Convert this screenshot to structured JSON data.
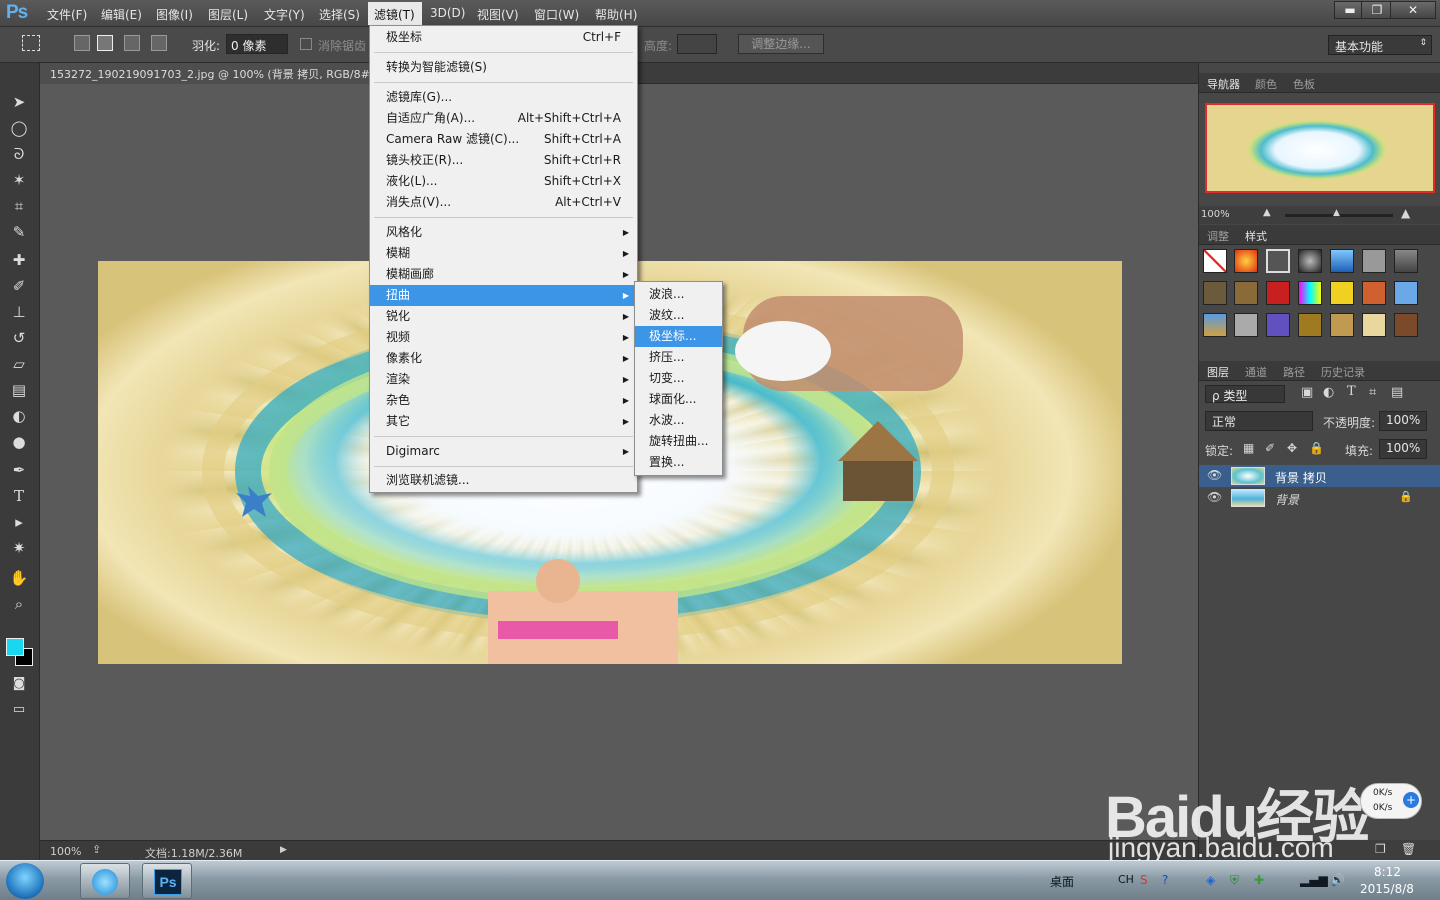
{
  "app": {
    "logo": "Ps"
  },
  "menubar": {
    "items": [
      "文件(F)",
      "编辑(E)",
      "图像(I)",
      "图层(L)",
      "文字(Y)",
      "选择(S)",
      "滤镜(T)",
      "3D(D)",
      "视图(V)",
      "窗口(W)",
      "帮助(H)"
    ],
    "window_controls": {
      "minimize": "▬",
      "restore": "❐",
      "close": "✕"
    }
  },
  "options": {
    "feather_label": "羽化:",
    "feather_value": "0 像素",
    "antialias": "消除锯齿",
    "height_label": "高度:",
    "refine_edge": "调整边缘...",
    "workspace": "基本功能"
  },
  "document": {
    "tab_title": "153272_190219091703_2.jpg @ 100% (背景 拷贝, RGB/8#)"
  },
  "status": {
    "zoom": "100%",
    "doc_info": "文档:1.18M/2.36M"
  },
  "filter_menu": {
    "items": [
      {
        "label": "极坐标",
        "shortcut": "Ctrl+F"
      },
      {
        "label": "转换为智能滤镜(S)",
        "shortcut": ""
      },
      {
        "label": "滤镜库(G)...",
        "shortcut": ""
      },
      {
        "label": "自适应广角(A)...",
        "shortcut": "Alt+Shift+Ctrl+A"
      },
      {
        "label": "Camera Raw 滤镜(C)...",
        "shortcut": "Shift+Ctrl+A"
      },
      {
        "label": "镜头校正(R)...",
        "shortcut": "Shift+Ctrl+R"
      },
      {
        "label": "液化(L)...",
        "shortcut": "Shift+Ctrl+X"
      },
      {
        "label": "消失点(V)...",
        "shortcut": "Alt+Ctrl+V"
      },
      {
        "label": "风格化",
        "shortcut": ""
      },
      {
        "label": "模糊",
        "shortcut": ""
      },
      {
        "label": "模糊画廊",
        "shortcut": ""
      },
      {
        "label": "扭曲",
        "shortcut": ""
      },
      {
        "label": "锐化",
        "shortcut": ""
      },
      {
        "label": "视频",
        "shortcut": ""
      },
      {
        "label": "像素化",
        "shortcut": ""
      },
      {
        "label": "渲染",
        "shortcut": ""
      },
      {
        "label": "杂色",
        "shortcut": ""
      },
      {
        "label": "其它",
        "shortcut": ""
      },
      {
        "label": "Digimarc",
        "shortcut": ""
      },
      {
        "label": "浏览联机滤镜...",
        "shortcut": ""
      }
    ]
  },
  "distort_submenu": {
    "items": [
      "波浪...",
      "波纹...",
      "极坐标...",
      "挤压...",
      "切变...",
      "球面化...",
      "水波...",
      "旋转扭曲...",
      "置换..."
    ]
  },
  "panels": {
    "nav_tabs": [
      "导航器",
      "颜色",
      "色板"
    ],
    "nav_zoom": "100%",
    "adjust_tabs": [
      "调整",
      "样式"
    ],
    "layer_tabs": [
      "图层",
      "通道",
      "路径",
      "历史记录"
    ],
    "kind_filter": "ρ 类型",
    "blend_mode": "正常",
    "opacity_label": "不透明度:",
    "opacity_value": "100%",
    "lock_label": "锁定:",
    "fill_label": "填充:",
    "fill_value": "100%",
    "layers": [
      "背景 拷贝",
      "背景"
    ]
  },
  "taskbar": {
    "desktop_label": "桌面",
    "ime": "CH",
    "net_up": "0K/s",
    "net_down": "0K/s",
    "time": "8:12",
    "date": "2015/8/8",
    "ps_label": "Ps"
  },
  "watermark": {
    "line1": "Baidu经验",
    "line2": "jingyan.baidu.com"
  },
  "colors": {
    "accent_blue": "#3d95e8",
    "foreground_swatch": "#1ad6f0"
  }
}
